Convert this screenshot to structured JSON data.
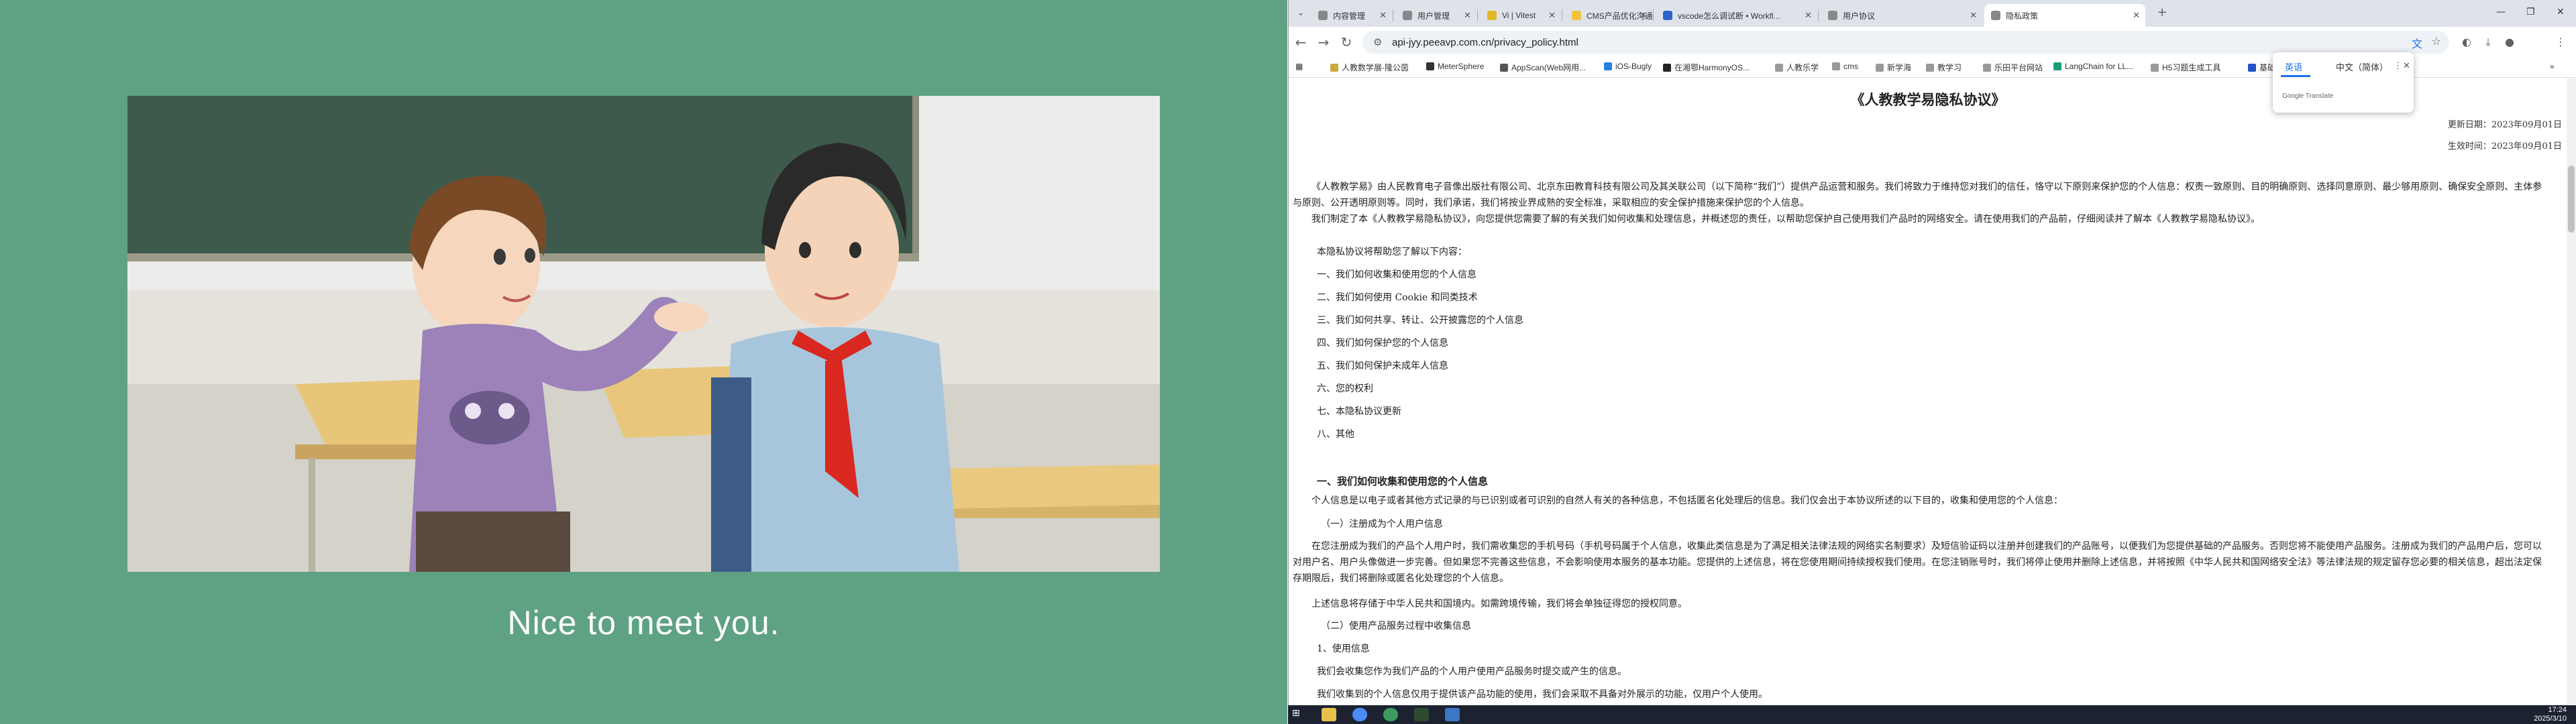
{
  "left_app": {
    "caption": "Nice to meet you."
  },
  "browser": {
    "tabs": [
      {
        "label": "内容管理",
        "active": false
      },
      {
        "label": "用户管理",
        "active": false
      },
      {
        "label": "Vi | Vitest",
        "active": false
      },
      {
        "label": "CMS产品优化沟通图述",
        "active": false
      },
      {
        "label": "vscode怎么调试断 • Workfl...",
        "active": false
      },
      {
        "label": "用户协议",
        "active": false
      },
      {
        "label": "隐私政策",
        "active": true
      }
    ],
    "url": "api-jyy.peeavp.com.cn/privacy_policy.html",
    "bookmarks": [
      "人教数学展-隆公茵",
      "MeterSphere",
      "AppScan(Web网用...",
      "iOS-Bugly",
      "在湘鄂HarmonyOS...",
      "人教乐学",
      "cms",
      "新学海",
      "教学习",
      "乐田平台网站",
      "LangChain for LL...",
      "H5习题生成工具",
      "基础平台人经数..."
    ],
    "translate": {
      "lang_en": "英语",
      "lang_zh": "中文（简体）",
      "provider": "Google Translate"
    }
  },
  "document": {
    "title": "《人教教学易隐私协议》",
    "updated": "更新日期：2023年09月01日",
    "effective": "生效时间：2023年09月01日",
    "intro": "《人教教学易》由人民教育电子音像出版社有限公司、北京东田教育科技有限公司及其关联公司（以下简称“我们”）提供产品运营和服务。我们将致力于维持您对我们的信任，恪守以下原则来保护您的个人信息：权责一致原则、目的明确原则、选择同意原则、最少够用原则、确保安全原则、主体参与原则、公开透明原则等。同时，我们承诺，我们将按业界成熟的安全标准，采取相应的安全保护措施来保护您的个人信息。",
    "intro2": "我们制定了本《人教教学易隐私协议》，向您提供您需要了解的有关我们如何收集和处理信息，并概述您的责任，以帮助您保护自己使用我们产品时的网络安全。请在使用我们的产品前，仔细阅读并了解本《人教教学易隐私协议》。",
    "toc_intro": "本隐私协议将帮助您了解以下内容：",
    "toc": [
      "一、我们如何收集和使用您的个人信息",
      "二、我们如何使用 Cookie 和同类技术",
      "三、我们如何共享、转让、公开披露您的个人信息",
      "四、我们如何保护您的个人信息",
      "五、我们如何保护未成年人信息",
      "六、您的权利",
      "七、本隐私协议更新",
      "八、其他"
    ],
    "sec1_title": "一、我们如何收集和使用您的个人信息",
    "sec1_p1": "个人信息是以电子或者其他方式记录的与已识别或者可识别的自然人有关的各种信息，不包括匿名化处理后的信息。我们仅会出于本协议所述的以下目的，收集和使用您的个人信息：",
    "sec1_sub1": "（一）注册成为个人用户信息",
    "sec1_p2": "在您注册成为我们的产品个人用户时，我们需收集您的手机号码（手机号码属于个人信息，收集此类信息是为了满足相关法律法规的网络实名制要求）及短信验证码以注册并创建我们的产品账号，以便我们为您提供基础的产品服务。否则您将不能使用产品服务。注册成为我们的产品用户后，您可以对用户名、用户头像做进一步完善。但如果您不完善这些信息，不会影响使用本服务的基本功能。您提供的上述信息，将在您使用期间持续授权我们使用。在您注销账号时，我们将停止使用并删除上述信息，并将按照《中华人民共和国网络安全法》等法律法规的规定留存您必要的相关信息，超出法定保存期限后，我们将删除或匿名化处理您的个人信息。",
    "sec1_p3": "上述信息将存储于中华人民共和国境内。如需跨境传输，我们将会单独征得您的授权同意。",
    "sec1_sub2": "（二）使用产品服务过程中收集信息",
    "sec1_sub2_1": "1、使用信息",
    "sec1_p4": "我们会收集您作为我们产品的个人用户使用产品服务时提交或产生的信息。",
    "sec1_p5": "我们收集到的个人信息仅用于提供该产品功能的使用，我们会采取不具备对外展示的功能，仅用户个人使用。"
  },
  "taskbar": {
    "time": "17:24",
    "date": "2025/3/10"
  }
}
